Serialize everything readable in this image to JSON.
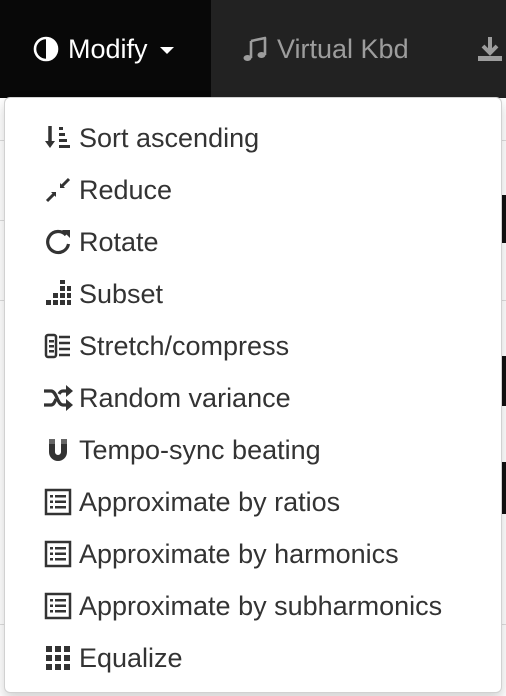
{
  "navbar": {
    "items": [
      {
        "label": "Modify",
        "icon": "adjust-icon",
        "active": true,
        "has_caret": true
      },
      {
        "label": "Virtual Kbd",
        "icon": "music-icon",
        "active": false
      },
      {
        "label": "",
        "icon": "download-icon",
        "active": false
      }
    ]
  },
  "menu": {
    "items": [
      {
        "label": "Sort ascending",
        "icon": "sort-ascending-icon"
      },
      {
        "label": "Reduce",
        "icon": "compress-arrows-icon"
      },
      {
        "label": "Rotate",
        "icon": "rotate-icon"
      },
      {
        "label": "Subset",
        "icon": "subset-icon"
      },
      {
        "label": "Stretch/compress",
        "icon": "stretch-icon"
      },
      {
        "label": "Random variance",
        "icon": "shuffle-icon"
      },
      {
        "label": "Tempo-sync beating",
        "icon": "magnet-icon"
      },
      {
        "label": "Approximate by ratios",
        "icon": "list-alt-icon"
      },
      {
        "label": "Approximate by harmonics",
        "icon": "list-alt-icon"
      },
      {
        "label": "Approximate by subharmonics",
        "icon": "list-alt-icon"
      },
      {
        "label": "Equalize",
        "icon": "grid-icon"
      }
    ]
  },
  "colors": {
    "navbar_bg": "#222222",
    "navbar_active_bg": "#080808",
    "navbar_text": "#9d9d9d",
    "menu_text": "#333333"
  }
}
